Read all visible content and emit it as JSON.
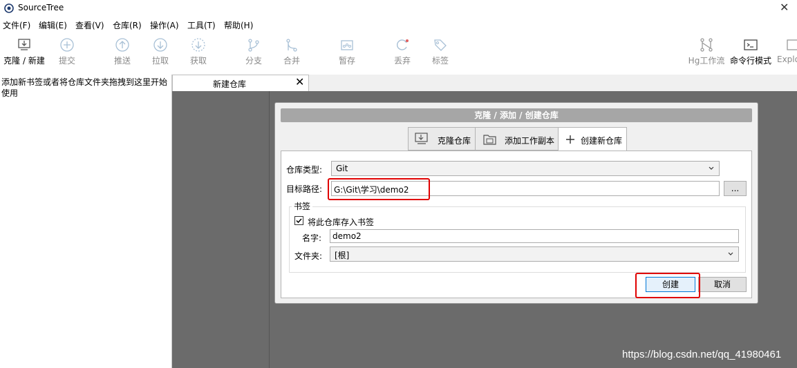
{
  "window": {
    "title": "SourceTree",
    "close_glyph": "✕"
  },
  "menu": [
    "文件(F)",
    "编辑(E)",
    "查看(V)",
    "仓库(R)",
    "操作(A)",
    "工具(T)",
    "帮助(H)"
  ],
  "toolbar": {
    "clone_new": "克隆 / 新建",
    "commit": "提交",
    "push": "推送",
    "pull": "拉取",
    "fetch": "获取",
    "branch": "分支",
    "merge": "合并",
    "stash": "暂存",
    "discard": "丢弃",
    "tag": "标签",
    "hg_flow": "Hg工作流",
    "terminal": "命令行模式",
    "explorer": "Explo"
  },
  "sidebar": {
    "hint": "添加新书签或者将仓库文件夹拖拽到这里开始使用"
  },
  "tab": {
    "label": "新建仓库",
    "close_glyph": "✕"
  },
  "dialog": {
    "title": "克隆 / 添加 / 创建仓库",
    "tabs": {
      "clone": "克隆仓库",
      "add_working_copy": "添加工作副本",
      "create_new": "创建新仓库"
    },
    "repo_type_label": "仓库类型:",
    "repo_type_value": "Git",
    "dest_path_label": "目标路径:",
    "dest_path_value": "G:\\Git\\学习\\demo2",
    "browse_label": "...",
    "bookmark_group": "书签",
    "bookmark_checkbox_label": "将此仓库存入书签",
    "bookmark_checked": true,
    "name_label": "名字:",
    "name_value": "demo2",
    "folder_label": "文件夹:",
    "folder_value": "[根]",
    "create_button": "创建",
    "cancel_button": "取消"
  },
  "watermark": "https://blog.csdn.net/qq_41980461",
  "colors": {
    "highlight": "#e00000",
    "content_bg": "#6b6b6b",
    "dialog_title_bg": "#a6a6a6",
    "icon_gray": "#8fb0cc"
  }
}
